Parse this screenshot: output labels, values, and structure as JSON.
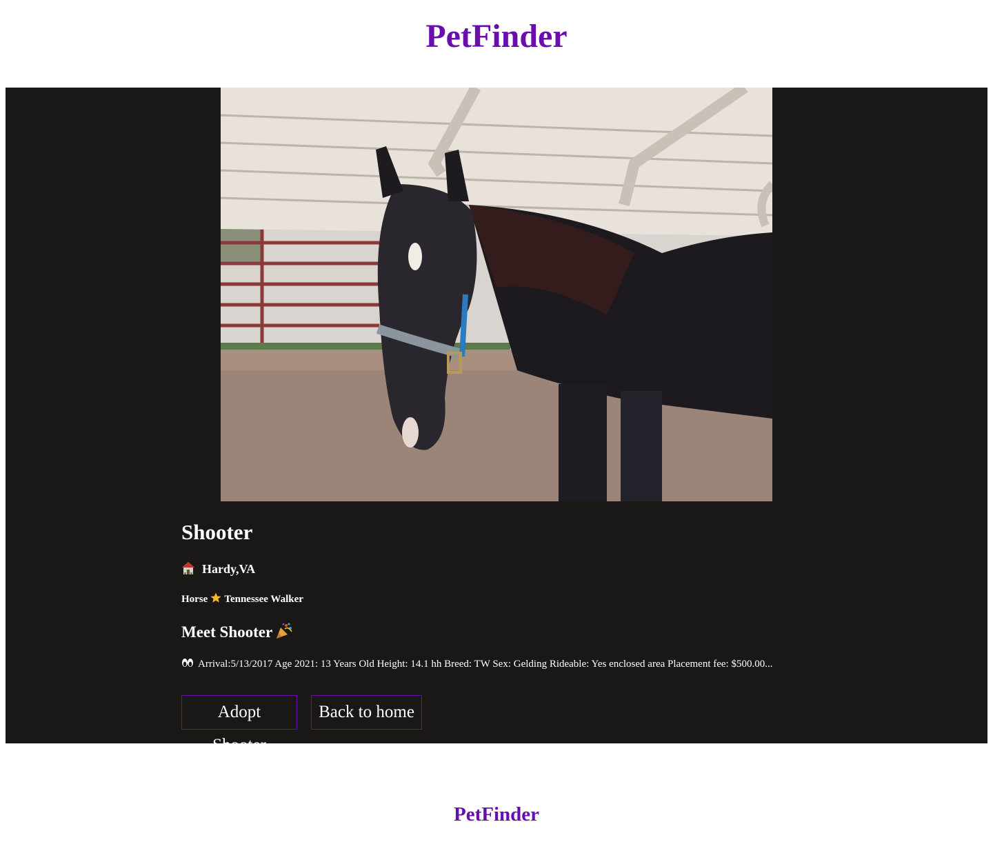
{
  "header": {
    "title": "PetFinder"
  },
  "pet": {
    "name": "Shooter",
    "location": "Hardy,VA",
    "location_icon": "house-icon",
    "species": "Horse",
    "separator_icon": "star-icon",
    "breed": "Tennessee Walker",
    "meet_heading": "Meet Shooter",
    "meet_icon": "party-popper-icon",
    "description_icon": "eyes-icon",
    "description": "Arrival:5/13/2017 Age 2021: 13 Years Old Height: 14.1 hh Breed: TW Sex: Gelding Rideable: Yes enclosed area Placement fee: $500.00..."
  },
  "actions": {
    "adopt_label": "Adopt Shooter",
    "home_label": "Back to home"
  },
  "footer": {
    "title": "PetFinder"
  },
  "colors": {
    "brand": "#6a0dad",
    "card_background": "#1a1817",
    "text": "#ffffff",
    "star": "#f5b82e"
  }
}
